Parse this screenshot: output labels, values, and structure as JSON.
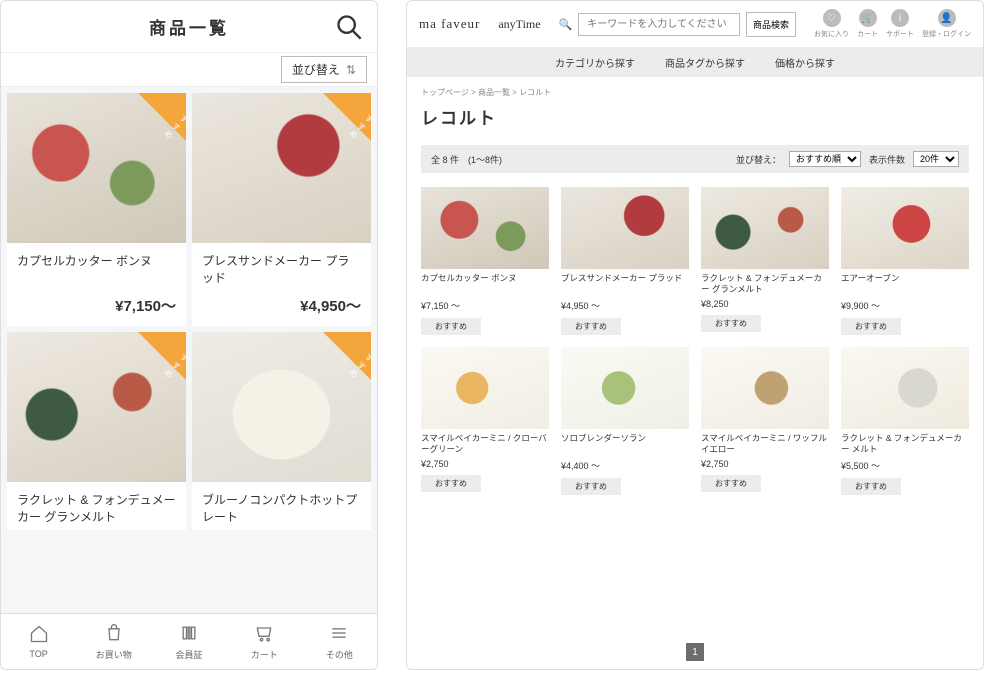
{
  "mobile": {
    "title": "商品一覧",
    "sort_label": "並び替え",
    "ribbon_label": "おすすめ",
    "products": [
      {
        "name": "カプセルカッター ボンヌ",
        "price": "¥7,150〜",
        "photo": "a"
      },
      {
        "name": "プレスサンドメーカー プラッド",
        "price": "¥4,950〜",
        "photo": "b"
      },
      {
        "name": "ラクレット & フォンデュメーカー グランメルト",
        "price": "",
        "photo": "c"
      },
      {
        "name": "ブルーノコンパクトホットプレート",
        "price": "",
        "photo": "d"
      }
    ],
    "tabs": [
      {
        "label": "TOP"
      },
      {
        "label": "お買い物"
      },
      {
        "label": "会員証"
      },
      {
        "label": "カート"
      },
      {
        "label": "その他"
      }
    ]
  },
  "desktop": {
    "logo1": "ma faveur",
    "logo2": "anyTime",
    "search_placeholder": "キーワードを入力してください",
    "search_button": "商品検索",
    "header_icons": [
      {
        "label": "お気に入り",
        "glyph": "♡"
      },
      {
        "label": "カート",
        "glyph": "🛒"
      },
      {
        "label": "サポート",
        "glyph": "i"
      },
      {
        "label": "登録・ログイン",
        "glyph": "👤"
      }
    ],
    "nav": [
      "カテゴリから探す",
      "商品タグから探す",
      "価格から探す"
    ],
    "breadcrumb": "トップページ > 商品一覧 > レコルト",
    "heading": "レコルト",
    "count_text": "全 8 件　(1〜8件)",
    "sort_label": "並び替え：",
    "sort_value": "おすすめ順",
    "per_label": "表示件数",
    "per_value": "20件",
    "tag_label": "おすすめ",
    "pager_current": "1",
    "products": [
      {
        "name": "カプセルカッター ボンヌ",
        "price": "¥7,150 〜",
        "photo": "a"
      },
      {
        "name": "プレスサンドメーカー プラッド",
        "price": "¥4,950 〜",
        "photo": "b"
      },
      {
        "name": "ラクレット & フォンデュメーカー グランメルト",
        "price": "¥8,250",
        "photo": "c"
      },
      {
        "name": "エアーオーブン",
        "price": "¥9,900 〜",
        "photo": "e"
      },
      {
        "name": "スマイルベイカーミニ / クローバーグリーン",
        "price": "¥2,750",
        "photo": "f"
      },
      {
        "name": "ソロブレンダーソラン",
        "price": "¥4,400 〜",
        "photo": "g"
      },
      {
        "name": "スマイルベイカーミニ / ワッフルイエロー",
        "price": "¥2,750",
        "photo": "h"
      },
      {
        "name": "ラクレット & フォンデュメーカー メルト",
        "price": "¥5,500 〜",
        "photo": "i"
      }
    ]
  }
}
